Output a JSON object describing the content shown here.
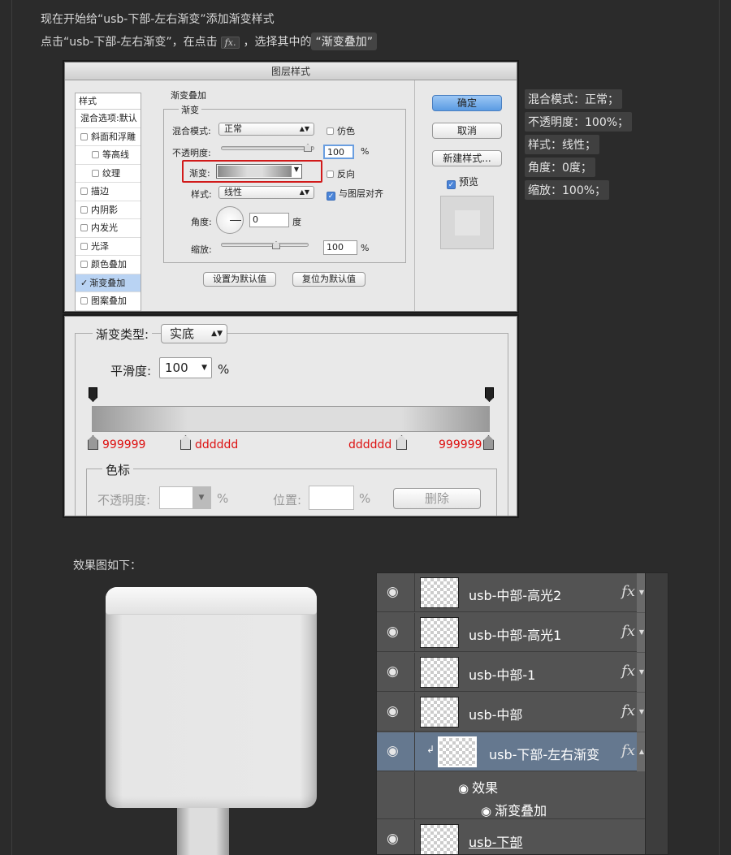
{
  "intro": {
    "line1": "现在开始给“usb-下部-左右渐变”添加渐变样式",
    "line2_pre": "点击“usb-下部-左右渐变”，在点击",
    "line2_fx": "fx.",
    "line2_mid": "，选择其中的",
    "line2_chip": "“渐变叠加”"
  },
  "dialog": {
    "title": "图层样式",
    "sidebar": {
      "header": "样式",
      "items": [
        {
          "label": "混合选项:默认",
          "checkbox": false,
          "sub": false,
          "selected": false
        },
        {
          "label": "斜面和浮雕",
          "checkbox": true,
          "checked": false,
          "sub": false
        },
        {
          "label": "等高线",
          "checkbox": true,
          "checked": false,
          "sub": true
        },
        {
          "label": "纹理",
          "checkbox": true,
          "checked": false,
          "sub": true
        },
        {
          "label": "描边",
          "checkbox": true,
          "checked": false,
          "sub": false
        },
        {
          "label": "内阴影",
          "checkbox": true,
          "checked": false,
          "sub": false
        },
        {
          "label": "内发光",
          "checkbox": true,
          "checked": false,
          "sub": false
        },
        {
          "label": "光泽",
          "checkbox": true,
          "checked": false,
          "sub": false
        },
        {
          "label": "颜色叠加",
          "checkbox": true,
          "checked": false,
          "sub": false
        },
        {
          "label": "渐变叠加",
          "checkbox": true,
          "checked": true,
          "sub": false,
          "selected": true
        },
        {
          "label": "图案叠加",
          "checkbox": true,
          "checked": false,
          "sub": false
        }
      ]
    },
    "section_title": "渐变叠加",
    "group_title": "渐变",
    "blend_label": "混合模式:",
    "blend_value": "正常",
    "dither_label": "仿色",
    "opacity_label": "不透明度:",
    "opacity_value": "100",
    "percent": "%",
    "gradient_label": "渐变:",
    "reverse_label": "反向",
    "style_label": "样式:",
    "style_value": "线性",
    "align_label": "与图层对齐",
    "angle_label": "角度:",
    "angle_value": "0",
    "degree": "度",
    "scale_label": "缩放:",
    "scale_value": "100",
    "set_default": "设置为默认值",
    "reset_default": "复位为默认值",
    "ok": "确定",
    "cancel": "取消",
    "new_style": "新建样式...",
    "preview": "预览",
    "highlight_color": "#d11a1a"
  },
  "editor": {
    "type_label": "渐变类型:",
    "type_value": "实底",
    "smooth_label": "平滑度:",
    "smooth_value": "100",
    "percent": "%",
    "stops": [
      {
        "label": "999999",
        "color": "#999999"
      },
      {
        "label": "dddddd",
        "color": "#dddddd"
      },
      {
        "label": "dddddd",
        "color": "#dddddd"
      },
      {
        "label": "999999",
        "color": "#999999"
      }
    ],
    "color_stop_title": "色标",
    "opacity_label": "不透明度:",
    "position_label": "位置:",
    "delete_label": "删除"
  },
  "notes": [
    "混合模式：正常；",
    "不透明度：100%；",
    "样式：线性；",
    "角度：0度；",
    "缩放：100%；"
  ],
  "result_label": "效果图如下：",
  "layers": [
    {
      "name": "usb-中部-高光2",
      "fx": "fx",
      "active": false,
      "underline": false
    },
    {
      "name": "usb-中部-高光1",
      "fx": "fx",
      "active": false,
      "underline": false
    },
    {
      "name": "usb-中部-1",
      "fx": "fx",
      "active": false,
      "underline": false
    },
    {
      "name": "usb-中部",
      "fx": "fx",
      "active": false,
      "underline": false
    },
    {
      "name": "usb-下部-左右渐变",
      "fx": "fx",
      "active": true,
      "underline": false
    },
    {
      "name": "usb-下部",
      "fx": "",
      "active": false,
      "underline": true
    }
  ],
  "effects": {
    "label": "效果",
    "item": "渐变叠加"
  }
}
